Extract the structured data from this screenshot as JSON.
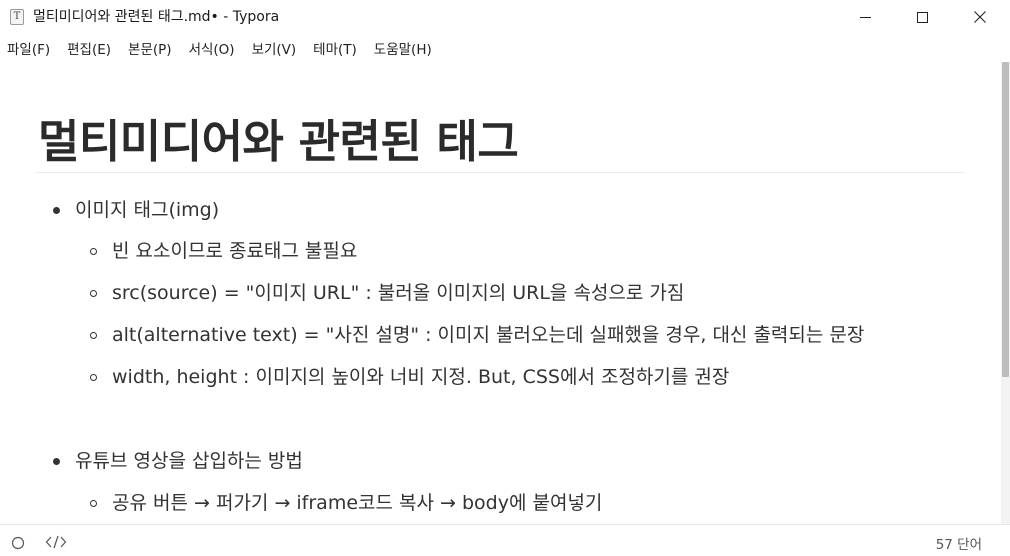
{
  "window": {
    "title": "멀티미디어와 관련된 태그.md• - Typora",
    "app_icon_glyph": "T"
  },
  "menubar": {
    "items": [
      "파일(F)",
      "편집(E)",
      "본문(P)",
      "서식(O)",
      "보기(V)",
      "테마(T)",
      "도움말(H)"
    ]
  },
  "document": {
    "heading": "멀티미디어와 관련된 태그",
    "list": [
      {
        "text": "이미지 태그(img)",
        "children": [
          "빈 요소이므로 종료태그 불필요",
          "src(source) = \"이미지 URL\" : 불러올 이미지의 URL을 속성으로 가짐",
          "alt(alternative text) = \"사진 설명\" : 이미지 불러오는데 실패했을 경우, 대신 출력되는 문장",
          "width, height : 이미지의 높이와 너비 지정. But, CSS에서 조정하기를 권장"
        ]
      },
      {
        "text": "유튜브 영상을 삽입하는 방법",
        "children": [
          "공유 버튼 → 퍼가기 → iframe코드 복사 → body에 붙여넣기"
        ]
      }
    ]
  },
  "statusbar": {
    "word_count": "57 단어"
  },
  "icons": {
    "app": "typora-app-icon",
    "minimize": "minimize-icon",
    "maximize": "maximize-icon",
    "close": "close-icon",
    "outline": "outline-toggle-icon",
    "source": "source-code-icon"
  },
  "colors": {
    "text": "#333333",
    "heading": "#2b2b2b",
    "scroll_thumb": "#bdbdbd"
  }
}
